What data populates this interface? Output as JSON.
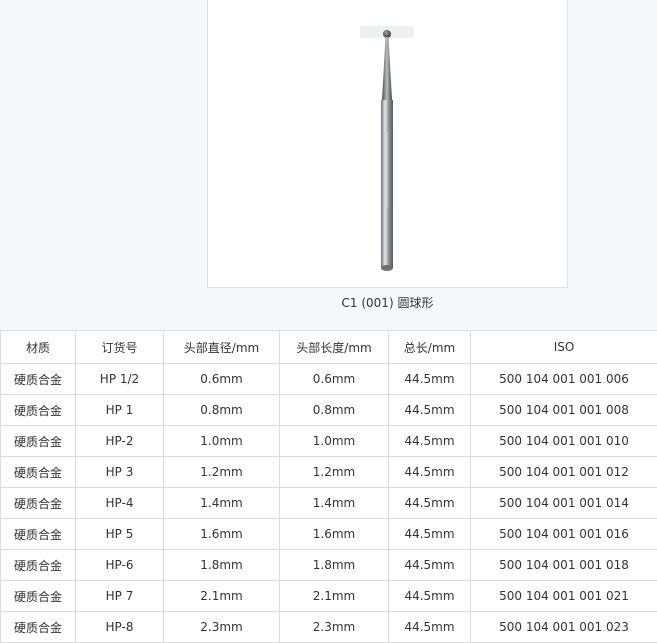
{
  "caption": "C1 (001) 圆球形",
  "table": {
    "headers": [
      "材质",
      "订货号",
      "头部直径/mm",
      "头部长度/mm",
      "总长/mm",
      "ISO"
    ],
    "rows": [
      [
        "硬质合金",
        "HP 1/2",
        "0.6mm",
        "0.6mm",
        "44.5mm",
        "500 104 001 001 006"
      ],
      [
        "硬质合金",
        "HP 1",
        "0.8mm",
        "0.8mm",
        "44.5mm",
        "500 104 001 001 008"
      ],
      [
        "硬质合金",
        "HP-2",
        "1.0mm",
        "1.0mm",
        "44.5mm",
        "500 104 001 001 010"
      ],
      [
        "硬质合金",
        "HP 3",
        "1.2mm",
        "1.2mm",
        "44.5mm",
        "500 104 001 001 012"
      ],
      [
        "硬质合金",
        "HP-4",
        "1.4mm",
        "1.4mm",
        "44.5mm",
        "500 104 001 001 014"
      ],
      [
        "硬质合金",
        "HP 5",
        "1.6mm",
        "1.6mm",
        "44.5mm",
        "500 104 001 001 016"
      ],
      [
        "硬质合金",
        "HP-6",
        "1.8mm",
        "1.8mm",
        "44.5mm",
        "500 104 001 001 018"
      ],
      [
        "硬质合金",
        "HP 7",
        "2.1mm",
        "2.1mm",
        "44.5mm",
        "500 104 001 001 021"
      ],
      [
        "硬质合金",
        "HP-8",
        "2.3mm",
        "2.3mm",
        "44.5mm",
        "500 104 001 001 023"
      ]
    ]
  }
}
